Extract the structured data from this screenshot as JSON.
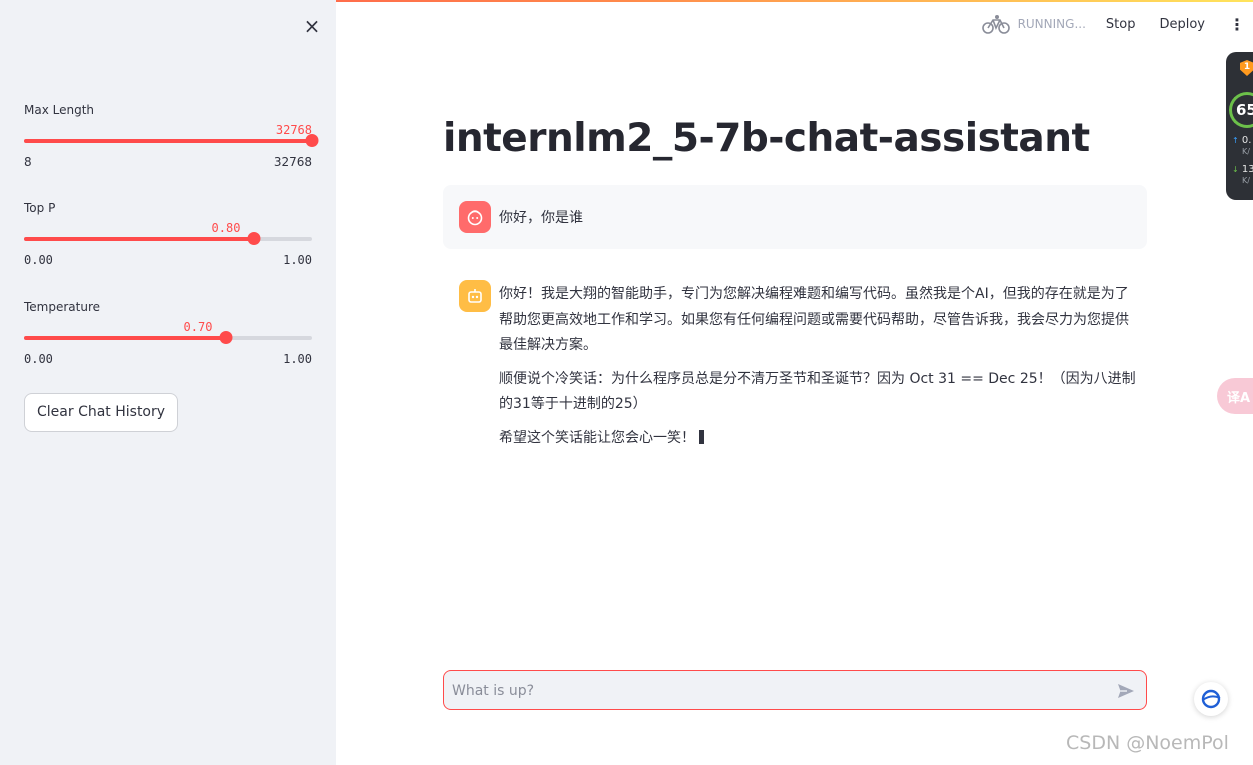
{
  "header": {
    "status": "RUNNING...",
    "stop_label": "Stop",
    "deploy_label": "Deploy"
  },
  "sidebar": {
    "close_label": "×",
    "sliders": [
      {
        "label": "Max Length",
        "value": "32768",
        "min": "8",
        "max": "32768",
        "fraction": 1.0
      },
      {
        "label": "Top P",
        "value": "0.80",
        "min": "0.00",
        "max": "1.00",
        "fraction": 0.8
      },
      {
        "label": "Temperature",
        "value": "0.70",
        "min": "0.00",
        "max": "1.00",
        "fraction": 0.7
      }
    ],
    "clear_label": "Clear Chat History"
  },
  "main": {
    "title": "internlm2_5-7b-chat-assistant",
    "messages": {
      "user": "你好，你是谁",
      "assistant_p1": "你好！我是大翔的智能助手，专门为您解决编程难题和编写代码。虽然我是个AI，但我的存在就是为了帮助您更高效地工作和学习。如果您有任何编程问题或需要代码帮助，尽管告诉我，我会尽力为您提供最佳解决方案。",
      "assistant_p2": "顺便说个冷笑话：为什么程序员总是分不清万圣节和圣诞节？因为 Oct 31 == Dec 25！（因为八进制的31等于十进制的25）",
      "assistant_p3": "希望这个笑话能让您会心一笑！"
    },
    "input": {
      "placeholder": "What is up?"
    }
  },
  "overlays": {
    "shield_badge": "1",
    "gauge_value": "65",
    "up_value": "0.",
    "up_unit": "K/",
    "down_value": "13",
    "down_unit": "K/",
    "translate_label": "译A"
  },
  "watermark": "CSDN @NoemPol",
  "colors": {
    "accent": "#ff4b4b",
    "sidebar_bg": "#f0f2f6",
    "user_avatar": "#ff6b6b",
    "bot_avatar": "#ffbd45"
  }
}
